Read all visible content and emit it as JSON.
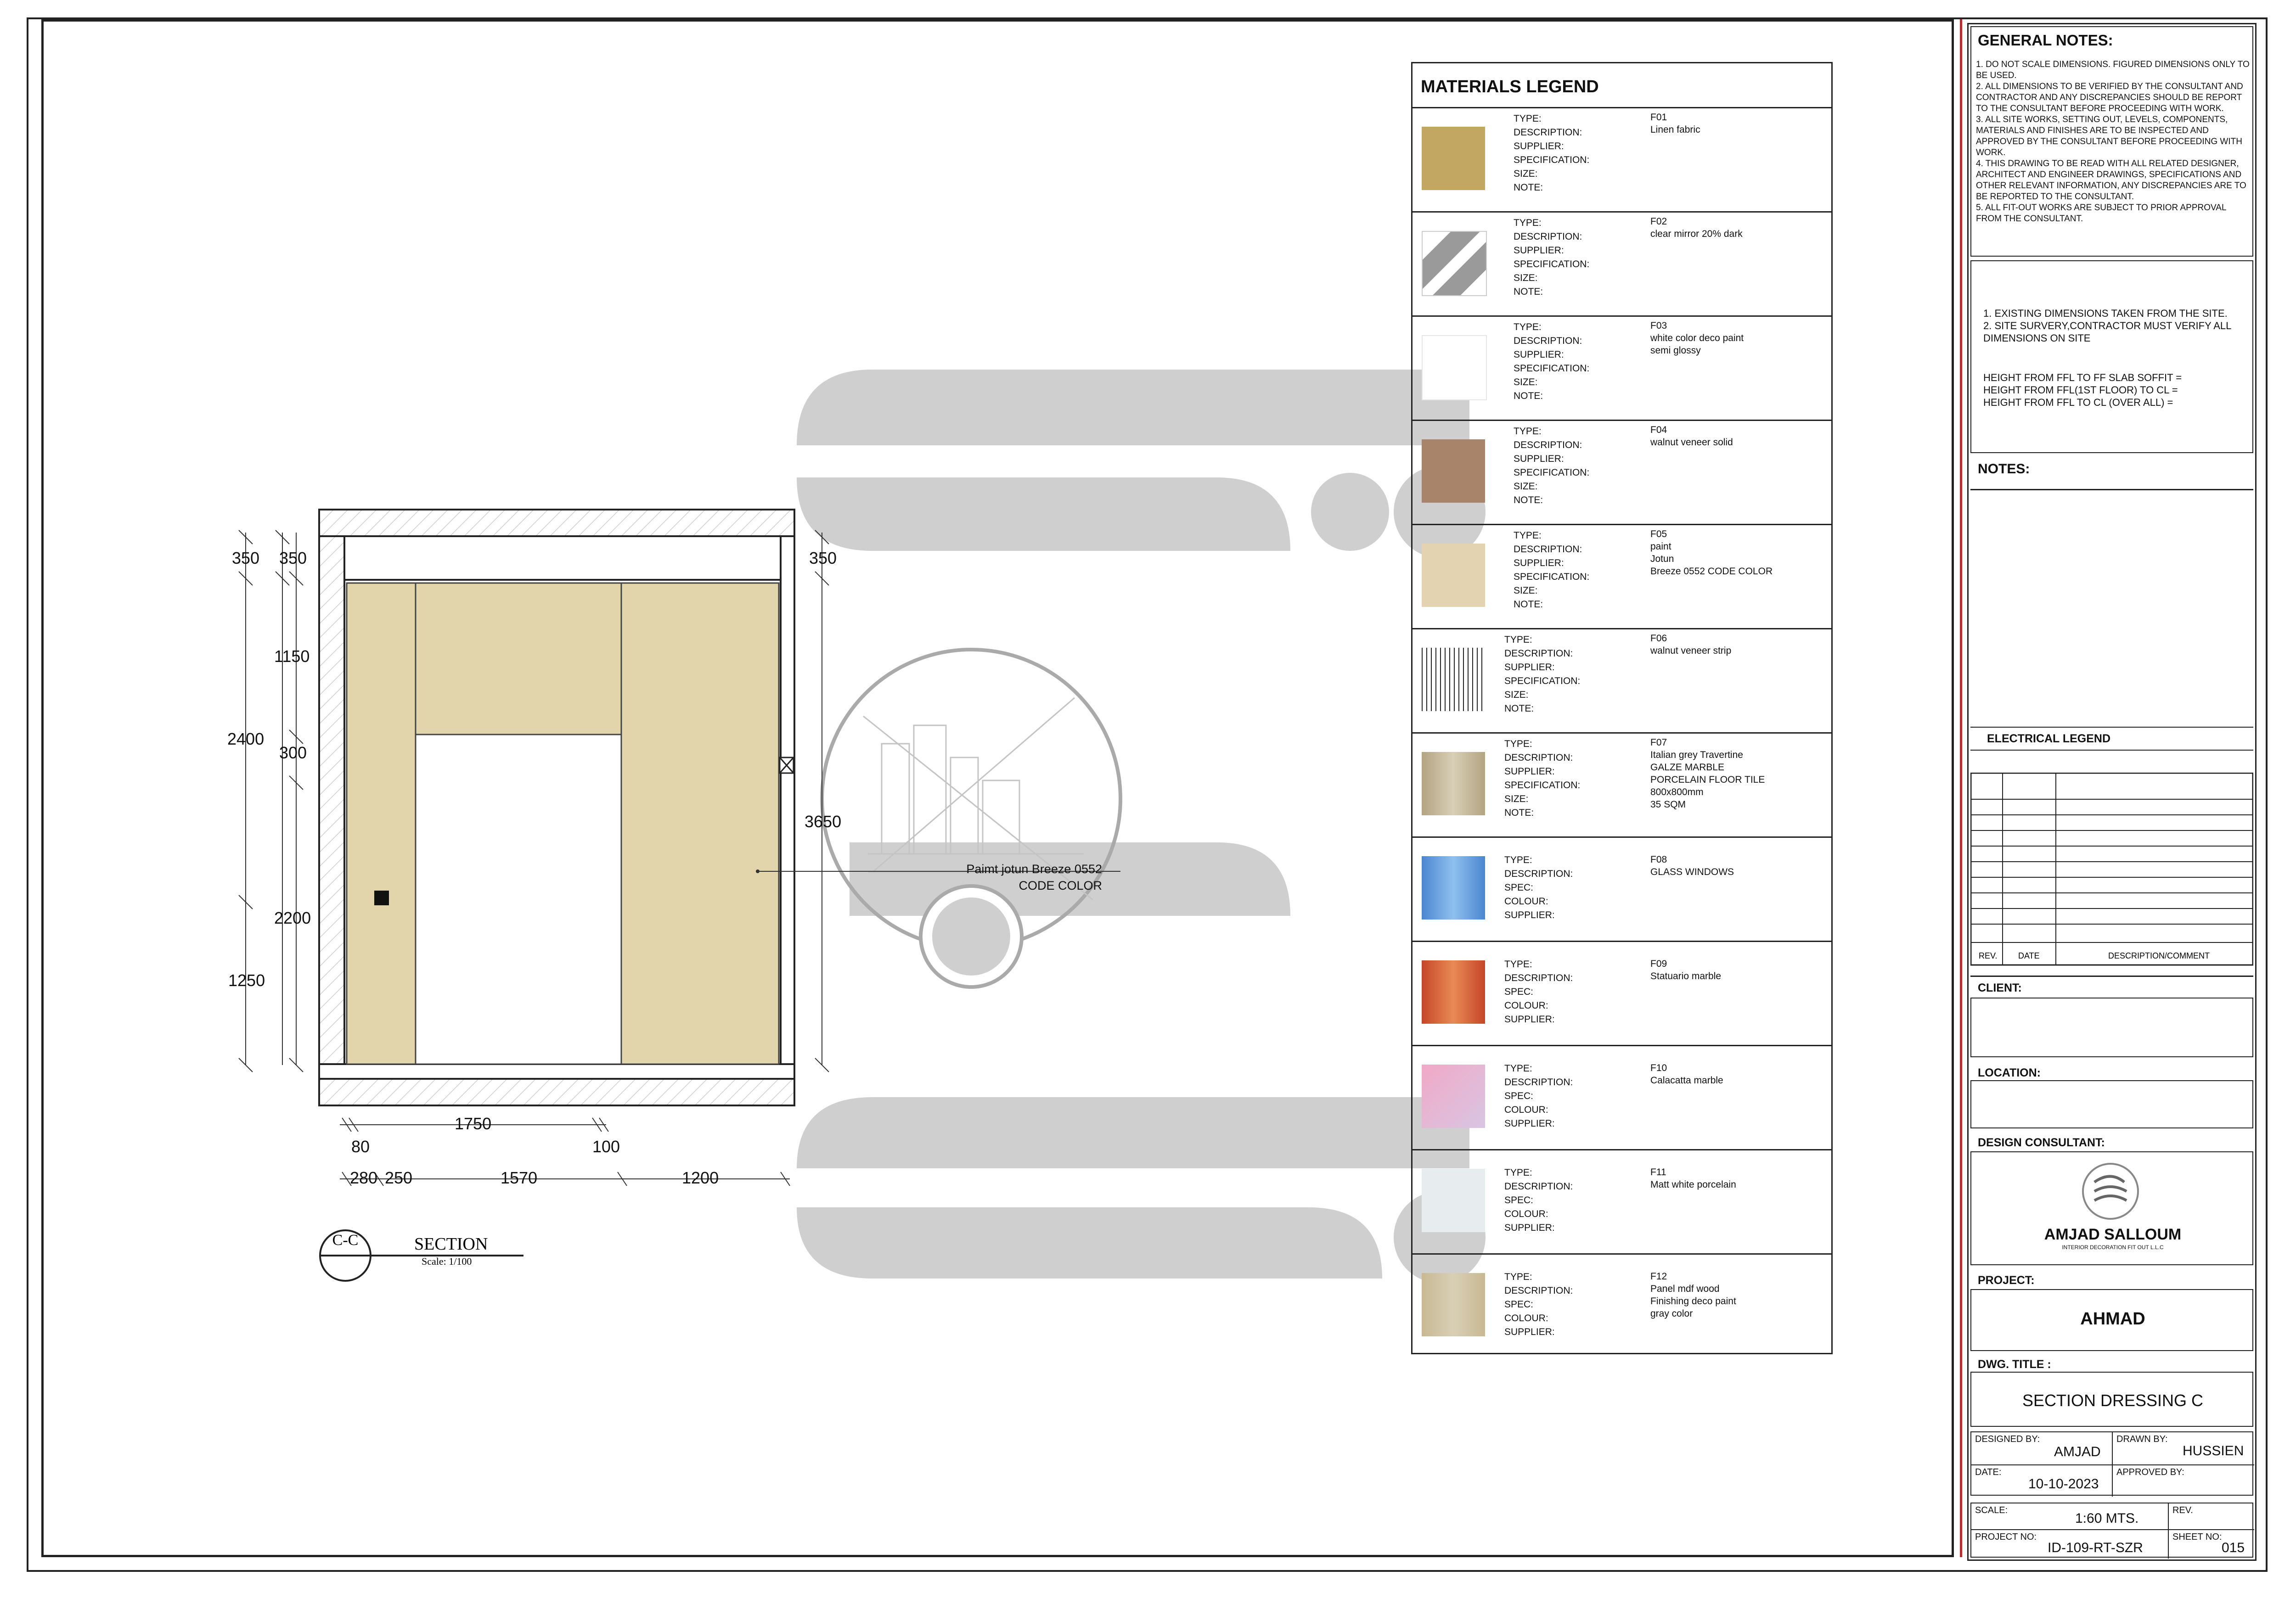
{
  "drawing": {
    "dimensions_left": [
      "350",
      "350",
      "2400",
      "1150",
      "300",
      "2200",
      "1250"
    ],
    "dimensions_right": [
      "350",
      "3650"
    ],
    "dimensions_bottom": [
      "1750",
      "80",
      "100",
      "280",
      "250",
      "1570",
      "1200"
    ],
    "annotation": "Paimt jotun Breeze 0552\nCODE COLOR",
    "section_tag": "C-C",
    "section_title": "SECTION",
    "section_scale": "Scale:  1/100"
  },
  "legend": {
    "title": "MATERIALS  LEGEND",
    "items": [
      {
        "labels": "TYPE:\nDESCRIPTION:\nSUPPLIER:\nSPECIFICATION:\nSIZE:\nNOTE:",
        "values": "F01\nLinen fabric",
        "color": "#c2a763"
      },
      {
        "labels": "TYPE:\nDESCRIPTION:\nSUPPLIER:\nSPECIFICATION:\nSIZE:\nNOTE:",
        "values": "F02\nclear mirror 20% dark",
        "color": "#999999"
      },
      {
        "labels": "TYPE:\nDESCRIPTION:\nSUPPLIER:\nSPECIFICATION:\nSIZE:\nNOTE:",
        "values": "F03\nwhite color deco paint\nsemi glossy",
        "color": "#ffffff"
      },
      {
        "labels": "TYPE:\nDESCRIPTION:\nSUPPLIER:\nSPECIFICATION:\nSIZE:\nNOTE:",
        "values": "F04\nwalnut veneer solid",
        "color": "#a7846a"
      },
      {
        "labels": "TYPE:\nDESCRIPTION:\nSUPPLIER:\nSPECIFICATION:\nSIZE:\nNOTE:",
        "values": "F05\npaint\nJotun\nBreeze 0552 CODE COLOR",
        "color": "#e3d3b0"
      },
      {
        "labels": "TYPE:\nDESCRIPTION:\nSUPPLIER:\nSPECIFICATION:\nSIZE:\nNOTE:",
        "values": "F06\nwalnut veneer strip",
        "color": "#ffffff"
      },
      {
        "labels": "TYPE:\nDESCRIPTION:\nSUPPLIER:\nSPECIFICATION:\nSIZE:\nNOTE:",
        "values": "F07\nItalian grey Travertine\nGALZE MARBLE\nPORCELAIN FLOOR TILE\n800x800mm\n35 SQM",
        "color": "#b3a482"
      },
      {
        "labels": "TYPE:\nDESCRIPTION:\nSPEC:\nCOLOUR:\nSUPPLIER:",
        "values": "F08\nGLASS WINDOWS",
        "color": "#5b9ad8"
      },
      {
        "labels": "TYPE:\nDESCRIPTION:\nSPEC:\nCOLOUR:\nSUPPLIER:",
        "values": "F09\nStatuario marble",
        "color": "#d9603a"
      },
      {
        "labels": "TYPE:\nDESCRIPTION:\nSPEC:\nCOLOUR:\nSUPPLIER:",
        "values": "F10\nCalacatta marble",
        "color": "#e8b3cc"
      },
      {
        "labels": "TYPE:\nDESCRIPTION:\nSPEC:\nCOLOUR:\nSUPPLIER:",
        "values": "F11\nMatt white porcelain",
        "color": "#e7ecef"
      },
      {
        "labels": "TYPE:\nDESCRIPTION:\nSPEC:\nCOLOUR:\nSUPPLIER:",
        "values": "F12\nPanel mdf wood\nFinishing deco paint\ngray color",
        "color": "#c8b992"
      }
    ]
  },
  "title_block": {
    "general_notes_title": "GENERAL NOTES:",
    "general_notes": "1. DO  NOT  SCALE  DIMENSIONS.  FIGURED  DIMENSIONS ONLY TO  BE USED.\n2. ALL DIMENSIONS TO BE VERIFIED BY THE CONSULTANT AND CONTRACTOR AND ANY DISCREPANCIES SHOULD BE REPORT TO THE CONSULTANT BEFORE PROCEEDING WITH WORK.\n3. ALL SITE WORKS, SETTING OUT, LEVELS, COMPONENTS, MATERIALS AND FINISHES ARE TO BE INSPECTED AND APPROVED BY THE CONSULTANT BEFORE PROCEEDING WITH WORK.\n4. THIS DRAWING TO BE READ WITH ALL RELATED DESIGNER, ARCHITECT AND ENGINEER DRAWINGS, SPECIFICATIONS AND OTHER RELEVANT INFORMATION, ANY DISCREPANCIES ARE TO BE REPORTED TO THE CONSULTANT.\n5. ALL FIT-OUT WORKS ARE SUBJECT TO PRIOR APPROVAL FROM THE CONSULTANT.",
    "site_notes": "1. EXISTING DIMENSIONS TAKEN FROM THE SITE.\n2. SITE SURVERY,CONTRACTOR MUST VERIFY ALL DIMENSIONS ON SITE",
    "height_notes": "HEIGHT FROM FFL TO FF SLAB SOFFIT =\nHEIGHT FROM FFL(1ST FLOOR) TO CL =\nHEIGHT FROM FFL TO CL (OVER ALL) =",
    "notes_title": "NOTES:",
    "electrical_legend": "ELECTRICAL LEGEND",
    "rev_header": {
      "rev": "REV.",
      "date": "DATE",
      "desc": "DESCRIPTION/COMMENT"
    },
    "client_label": "CLIENT:",
    "location_label": "LOCATION:",
    "consultant_label": "DESIGN CONSULTANT:",
    "consultant_name": "AMJAD SALLOUM",
    "consultant_sub": "INTERIOR DECORATION FIT OUT L.L.C",
    "project_label": "PROJECT:",
    "project_name": "AHMAD",
    "dwg_title_label": "DWG. TITLE :",
    "dwg_title": "SECTION  DRESSING C",
    "designed_by_label": "DESIGNED BY:",
    "designed_by": "AMJAD",
    "drawn_by_label": "DRAWN BY:",
    "drawn_by": "HUSSIEN",
    "date_label": "DATE:",
    "date": "10-10-2023",
    "approved_by_label": "APPROVED BY:",
    "scale_label": "SCALE:",
    "scale": "1:60 MTS.",
    "rev_label": "REV.",
    "project_no_label": "PROJECT NO:",
    "project_no": "ID-109-RT-SZR",
    "sheet_no_label": "SHEET NO:",
    "sheet_no": "015"
  }
}
